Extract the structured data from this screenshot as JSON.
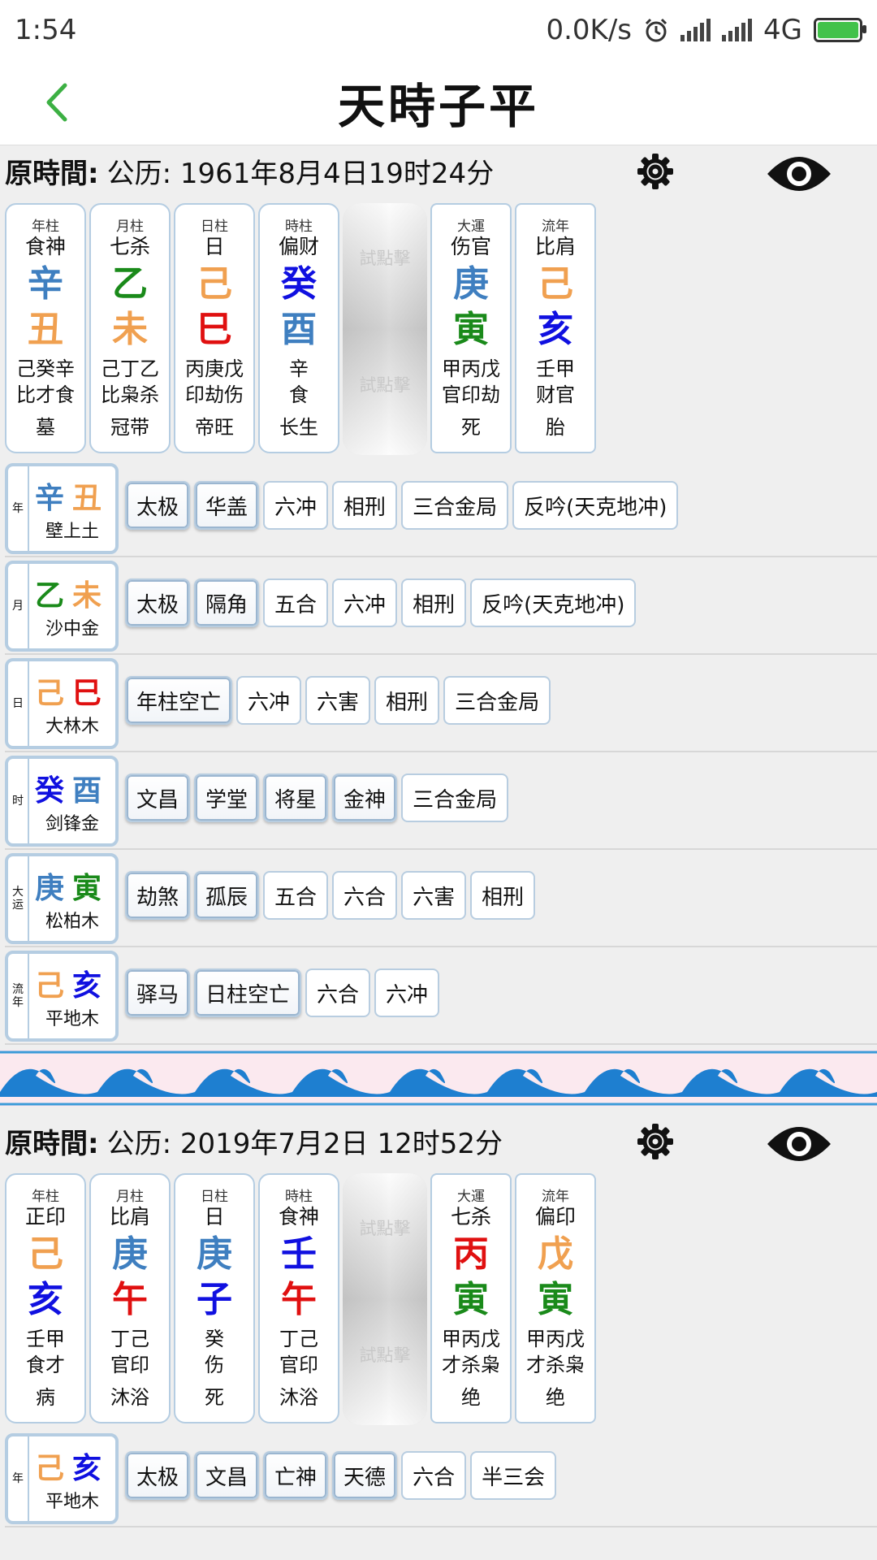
{
  "status": {
    "time": "1:54",
    "speed": "0.0K/s",
    "network": "4G"
  },
  "header": {
    "title": "天時子平"
  },
  "tap_hint": "試點擊",
  "orig_label": "原時間:",
  "charts": [
    {
      "orig_time": "公历: 1961年8月4日19时24分",
      "pillars": [
        {
          "label": "年柱",
          "god": "食神",
          "stem": "辛",
          "stem_color": "#3f7fc0",
          "branch": "丑",
          "branch_color": "#f0a050",
          "hidden1": "己癸辛",
          "hidden2": "比才食",
          "phase": "墓"
        },
        {
          "label": "月柱",
          "god": "七杀",
          "stem": "乙",
          "stem_color": "#1a8a1a",
          "branch": "未",
          "branch_color": "#f0a050",
          "hidden1": "己丁乙",
          "hidden2": "比枭杀",
          "phase": "冠带"
        },
        {
          "label": "日柱",
          "god": "日",
          "stem": "己",
          "stem_color": "#f0a050",
          "branch": "巳",
          "branch_color": "#e01010",
          "hidden1": "丙庚戊",
          "hidden2": "印劫伤",
          "phase": "帝旺"
        },
        {
          "label": "時柱",
          "god": "偏财",
          "stem": "癸",
          "stem_color": "#1010e0",
          "branch": "酉",
          "branch_color": "#3f7fc0",
          "hidden1": "辛",
          "hidden2": "食",
          "phase": "长生"
        }
      ],
      "extra": [
        {
          "label": "大運",
          "god": "伤官",
          "stem": "庚",
          "stem_color": "#3f7fc0",
          "branch": "寅",
          "branch_color": "#1a8a1a",
          "hidden1": "甲丙戊",
          "hidden2": "官印劫",
          "phase": "死"
        },
        {
          "label": "流年",
          "god": "比肩",
          "stem": "己",
          "stem_color": "#f0a050",
          "branch": "亥",
          "branch_color": "#1010e0",
          "hidden1": "壬甲",
          "hidden2": "财官",
          "phase": "胎"
        }
      ],
      "rows": [
        {
          "side": "年",
          "stem": "辛",
          "stem_color": "#3f7fc0",
          "branch": "丑",
          "branch_color": "#f0a050",
          "nayin": "壁上土",
          "tags": [
            "太极",
            "华盖",
            "六冲",
            "相刑",
            "三合金局",
            "反吟(天克地冲)"
          ],
          "hl": [
            true,
            true,
            false,
            false,
            false,
            false
          ]
        },
        {
          "side": "月",
          "stem": "乙",
          "stem_color": "#1a8a1a",
          "branch": "未",
          "branch_color": "#f0a050",
          "nayin": "沙中金",
          "tags": [
            "太极",
            "隔角",
            "五合",
            "六冲",
            "相刑",
            "反吟(天克地冲)"
          ],
          "hl": [
            true,
            true,
            false,
            false,
            false,
            false
          ]
        },
        {
          "side": "日",
          "stem": "己",
          "stem_color": "#f0a050",
          "branch": "巳",
          "branch_color": "#e01010",
          "nayin": "大林木",
          "tags": [
            "年柱空亡",
            "六冲",
            "六害",
            "相刑",
            "三合金局"
          ],
          "hl": [
            true,
            false,
            false,
            false,
            false
          ]
        },
        {
          "side": "时",
          "stem": "癸",
          "stem_color": "#1010e0",
          "branch": "酉",
          "branch_color": "#3f7fc0",
          "nayin": "剑锋金",
          "tags": [
            "文昌",
            "学堂",
            "将星",
            "金神",
            "三合金局"
          ],
          "hl": [
            true,
            true,
            true,
            true,
            false
          ]
        },
        {
          "side": "大运",
          "stem": "庚",
          "stem_color": "#3f7fc0",
          "branch": "寅",
          "branch_color": "#1a8a1a",
          "nayin": "松柏木",
          "tags": [
            "劫煞",
            "孤辰",
            "五合",
            "六合",
            "六害",
            "相刑"
          ],
          "hl": [
            true,
            true,
            false,
            false,
            false,
            false
          ]
        },
        {
          "side": "流年",
          "stem": "己",
          "stem_color": "#f0a050",
          "branch": "亥",
          "branch_color": "#1010e0",
          "nayin": "平地木",
          "tags": [
            "驿马",
            "日柱空亡",
            "六合",
            "六冲"
          ],
          "hl": [
            true,
            true,
            false,
            false
          ]
        }
      ]
    },
    {
      "orig_time": "公历: 2019年7月2日 12时52分",
      "pillars": [
        {
          "label": "年柱",
          "god": "正印",
          "stem": "己",
          "stem_color": "#f0a050",
          "branch": "亥",
          "branch_color": "#1010e0",
          "hidden1": "壬甲",
          "hidden2": "食才",
          "phase": "病"
        },
        {
          "label": "月柱",
          "god": "比肩",
          "stem": "庚",
          "stem_color": "#3f7fc0",
          "branch": "午",
          "branch_color": "#e01010",
          "hidden1": "丁己",
          "hidden2": "官印",
          "phase": "沐浴"
        },
        {
          "label": "日柱",
          "god": "日",
          "stem": "庚",
          "stem_color": "#3f7fc0",
          "branch": "子",
          "branch_color": "#1010e0",
          "hidden1": "癸",
          "hidden2": "伤",
          "phase": "死"
        },
        {
          "label": "時柱",
          "god": "食神",
          "stem": "壬",
          "stem_color": "#1010e0",
          "branch": "午",
          "branch_color": "#e01010",
          "hidden1": "丁己",
          "hidden2": "官印",
          "phase": "沐浴"
        }
      ],
      "extra": [
        {
          "label": "大運",
          "god": "七杀",
          "stem": "丙",
          "stem_color": "#e01010",
          "branch": "寅",
          "branch_color": "#1a8a1a",
          "hidden1": "甲丙戊",
          "hidden2": "才杀枭",
          "phase": "绝"
        },
        {
          "label": "流年",
          "god": "偏印",
          "stem": "戊",
          "stem_color": "#f0a050",
          "branch": "寅",
          "branch_color": "#1a8a1a",
          "hidden1": "甲丙戊",
          "hidden2": "才杀枭",
          "phase": "绝"
        }
      ],
      "rows": [
        {
          "side": "年",
          "stem": "己",
          "stem_color": "#f0a050",
          "branch": "亥",
          "branch_color": "#1010e0",
          "nayin": "平地木",
          "tags": [
            "太极",
            "文昌",
            "亡神",
            "天德",
            "六合",
            "半三会"
          ],
          "hl": [
            true,
            true,
            true,
            true,
            false,
            false
          ]
        }
      ]
    }
  ]
}
